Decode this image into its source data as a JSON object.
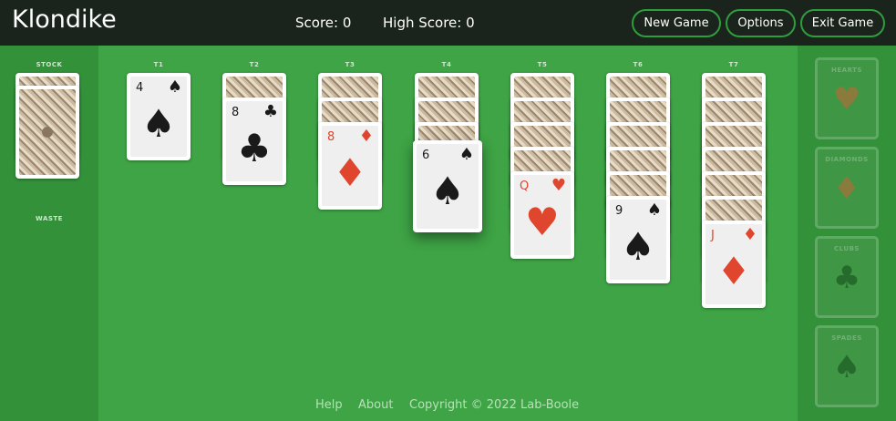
{
  "header": {
    "title": "Klondike",
    "score": "Score: 0",
    "high_score": "High Score: 0",
    "new_game_label": "New Game",
    "options_label": "Options",
    "exit_label": "Exit Game"
  },
  "stock": {
    "label": "STOCK",
    "cards": "face-down"
  },
  "waste": {
    "label": "WASTE",
    "cards": "empty"
  },
  "tableau": [
    {
      "label": "T1",
      "hidden": 0,
      "visible": [
        {
          "rank": "4",
          "suit": "♠",
          "color": "black"
        }
      ]
    },
    {
      "label": "T2",
      "hidden": 1,
      "visible": [
        {
          "rank": "8",
          "suit": "♣",
          "color": "black"
        }
      ]
    },
    {
      "label": "T3",
      "hidden": 2,
      "visible": [
        {
          "rank": "8",
          "suit": "♦",
          "color": "red"
        }
      ]
    },
    {
      "label": "T4",
      "hidden": 3,
      "visible": [
        {
          "rank": "6",
          "suit": "♠",
          "color": "black"
        }
      ]
    },
    {
      "label": "T5",
      "hidden": 4,
      "visible": [
        {
          "rank": "Q",
          "suit": "♥",
          "color": "red"
        }
      ]
    },
    {
      "label": "T6",
      "hidden": 5,
      "visible": [
        {
          "rank": "9",
          "suit": "♠",
          "color": "black"
        }
      ]
    },
    {
      "label": "T7",
      "hidden": 6,
      "visible": [
        {
          "rank": "J",
          "suit": "♦",
          "color": "red"
        }
      ]
    }
  ],
  "foundations": [
    {
      "label": "HEARTS",
      "suit": "♥",
      "tint": "#8a7a3c"
    },
    {
      "label": "DIAMONDS",
      "suit": "♦",
      "tint": "#8a7a3c"
    },
    {
      "label": "CLUBS",
      "suit": "♣",
      "tint": "#256b2c"
    },
    {
      "label": "SPADES",
      "suit": "♠",
      "tint": "#256b2c"
    }
  ],
  "footer": {
    "help": "Help",
    "about": "About",
    "copyright": "Copyright © 2022 Lab-Boole"
  }
}
